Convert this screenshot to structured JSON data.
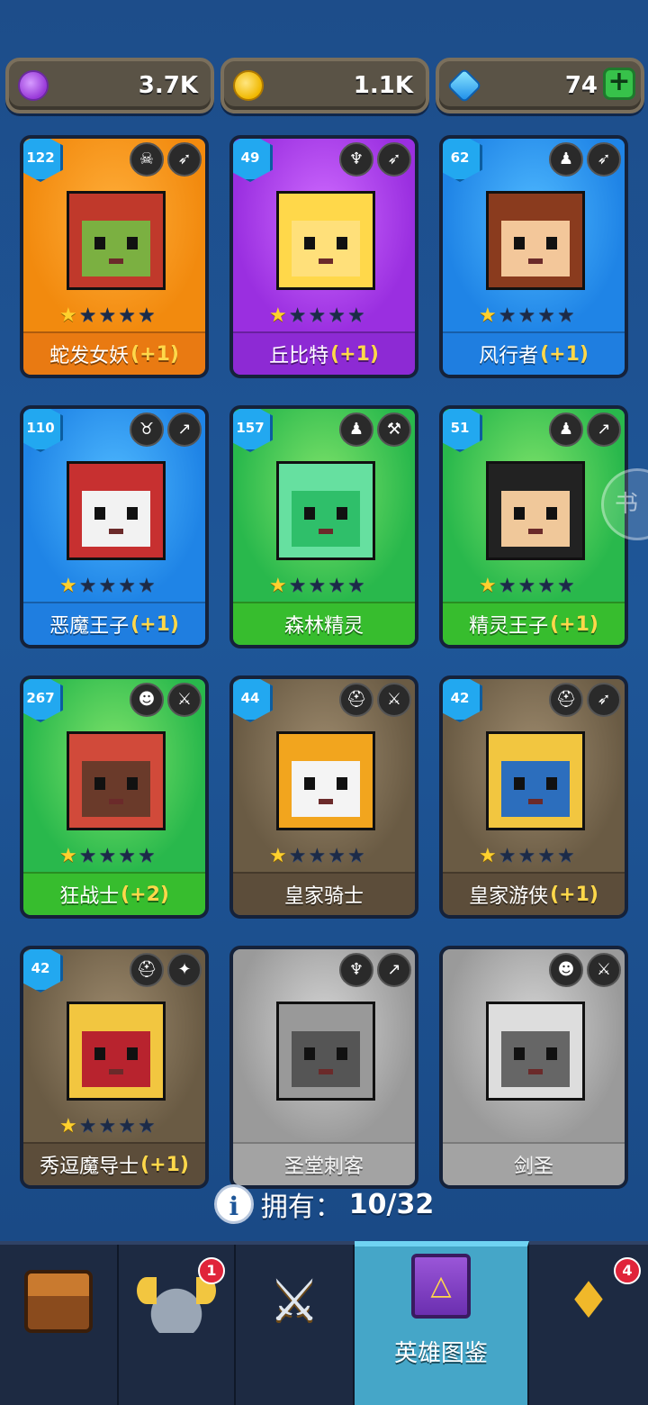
{
  "currency": {
    "elixir": "3.7K",
    "coins": "1.1K",
    "gems": "74",
    "add_label": "+"
  },
  "heroes": [
    {
      "level": "122",
      "name": "蛇发女妖",
      "bonus": "(+1)",
      "stars": 1,
      "theme": "orange",
      "traits": [
        "skull-icon",
        "bow-icon"
      ]
    },
    {
      "level": "49",
      "name": "丘比特",
      "bonus": "(+1)",
      "stars": 1,
      "theme": "purple",
      "traits": [
        "wings-icon",
        "bow-icon"
      ]
    },
    {
      "level": "62",
      "name": "风行者",
      "bonus": "(+1)",
      "stars": 1,
      "theme": "blue",
      "traits": [
        "elf-icon",
        "bow-icon"
      ]
    },
    {
      "level": "110",
      "name": "恶魔王子",
      "bonus": "(+1)",
      "stars": 1,
      "theme": "blue",
      "traits": [
        "demon-icon",
        "dagger-icon"
      ]
    },
    {
      "level": "157",
      "name": "森林精灵",
      "bonus": "",
      "stars": 1,
      "theme": "green",
      "traits": [
        "elf-icon",
        "hammer-icon"
      ]
    },
    {
      "level": "51",
      "name": "精灵王子",
      "bonus": "(+1)",
      "stars": 1,
      "theme": "green",
      "traits": [
        "elf-icon",
        "dagger-icon"
      ]
    },
    {
      "level": "267",
      "name": "狂战士",
      "bonus": "(+2)",
      "stars": 1,
      "theme": "green",
      "traits": [
        "orc-icon",
        "sword-icon"
      ]
    },
    {
      "level": "44",
      "name": "皇家骑士",
      "bonus": "",
      "stars": 1,
      "theme": "brown",
      "traits": [
        "helmet-icon",
        "sword-icon"
      ]
    },
    {
      "level": "42",
      "name": "皇家游侠",
      "bonus": "(+1)",
      "stars": 1,
      "theme": "brown",
      "traits": [
        "helmet-icon",
        "bow-icon"
      ]
    },
    {
      "level": "42",
      "name": "秀逗魔导士",
      "bonus": "(+1)",
      "stars": 1,
      "theme": "brown",
      "traits": [
        "helmet-icon",
        "wand-icon"
      ]
    },
    {
      "level": "",
      "name": "圣堂刺客",
      "bonus": "",
      "stars": 0,
      "theme": "gray",
      "traits": [
        "wings-icon",
        "dagger-icon"
      ]
    },
    {
      "level": "",
      "name": "剑圣",
      "bonus": "",
      "stars": 0,
      "theme": "gray",
      "traits": [
        "orc-icon",
        "sword-icon"
      ]
    }
  ],
  "owned": {
    "label": "拥有：",
    "count": "10/32"
  },
  "side_button": "书",
  "nav": [
    {
      "icon": "chest-icon",
      "label": "",
      "badge": ""
    },
    {
      "icon": "helmet-icon",
      "label": "",
      "badge": "1"
    },
    {
      "icon": "crossed-swords-icon",
      "label": "",
      "badge": ""
    },
    {
      "icon": "hero-book-icon",
      "label": "英雄图鉴",
      "badge": "",
      "active": true
    },
    {
      "icon": "amulet-icon",
      "label": "",
      "badge": "4"
    }
  ],
  "colors": {
    "background": "#1e5698",
    "gold": "#ffd12e",
    "bonus": "#ffd84a",
    "badge": "#e0243a"
  }
}
